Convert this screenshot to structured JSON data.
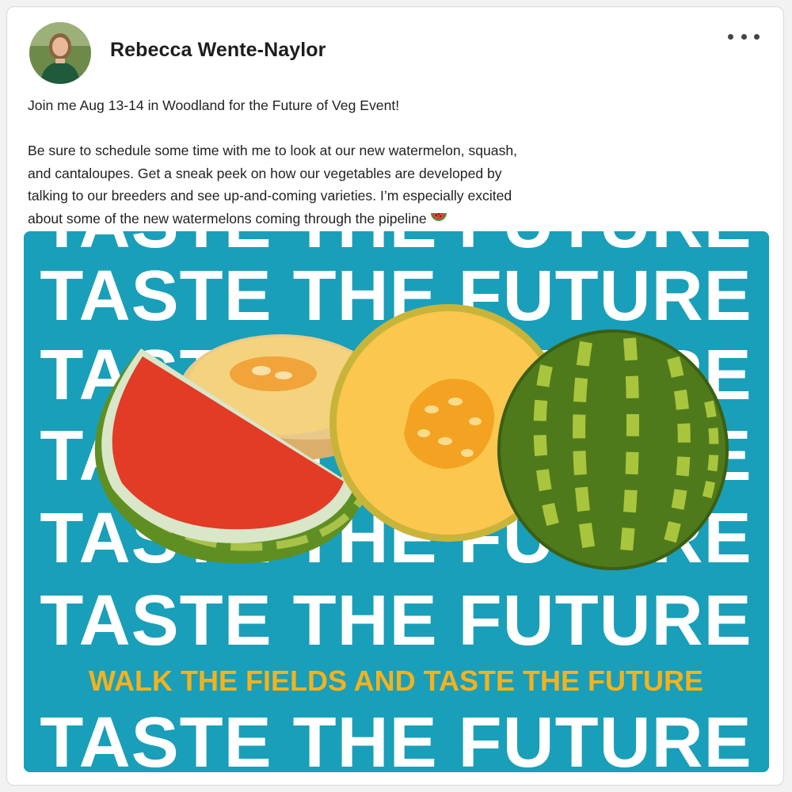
{
  "post": {
    "author": "Rebecca Wente-Naylor",
    "text_line1": "Join me Aug 13-14 in Woodland for the Future of Veg Event!",
    "text_para2_line1": "Be sure to schedule some time with me to look at our new watermelon, squash,",
    "text_para2_line2": "and cantaloupes. Get a sneak peek on how our vegetables are developed by",
    "text_para2_line3": "talking to our breeders and see up-and-coming varieties. I’m especially excited",
    "text_para2_line4": "about some of the new watermelons coming through the pipeline"
  },
  "banner": {
    "repeat_text": "TASTE THE FUTURE",
    "tagline": "WALK THE FIELDS AND TASTE THE FUTURE",
    "colors": {
      "background": "#199fb9",
      "text": "#ffffff",
      "tagline": "#f5b21c"
    }
  },
  "icons": {
    "more": "more-options-icon",
    "emoji": "watermelon-emoji-icon"
  }
}
